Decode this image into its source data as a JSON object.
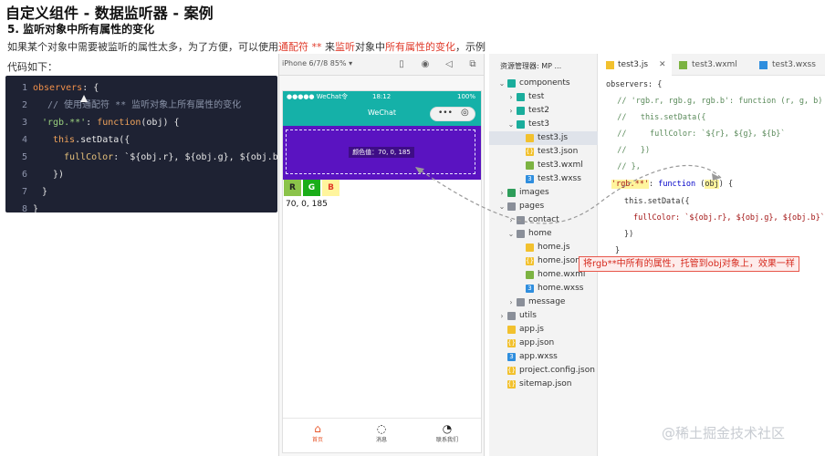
{
  "page": {
    "title": "自定义组件 - 数据监听器 - 案例",
    "heading": "5. 监听对象中所有属性的变化",
    "desc_1": "如果某个对象中需要被监听的属性太多，为了方便，可以使用",
    "desc_2": "通配符 **",
    "desc_3": " 来",
    "desc_4": "监听",
    "desc_5": "对象中",
    "desc_6": "所有属性的变化",
    "desc_7": "，示例",
    "code_label": "代码如下："
  },
  "code_panel": {
    "lines": [
      {
        "num": "1"
      },
      {
        "num": "2"
      },
      {
        "num": "3"
      },
      {
        "num": "4"
      },
      {
        "num": "5"
      },
      {
        "num": "6"
      },
      {
        "num": "7"
      },
      {
        "num": "8"
      }
    ],
    "l1_key": "observers",
    "l1_rest": ": {",
    "l2": "// 使用通配符 ** 监听对象上所有属性的变化",
    "l3_str": "'rgb.**'",
    "l3_mid": ": ",
    "l3_fn": "function",
    "l3_rest": "(obj) {",
    "l4_this": "this",
    "l4_rest": ".setData({",
    "l5_key": "fullColor",
    "l5_rest": ": `${obj.r}, ${obj.g}, ${obj.b}`",
    "l6": "})",
    "l7": "}",
    "l8": "}"
  },
  "simulator": {
    "device": "iPhone 6/7/8 85% ▾",
    "status_left": "●●●●● WeChat令",
    "status_time": "18:12",
    "status_right": "100%",
    "nav_title": "WeChat",
    "color_label": "颜色值：70, 0, 185",
    "buttons": [
      {
        "label": "R",
        "color": "#8bc34a"
      },
      {
        "label": "G",
        "color": "#1aad19"
      },
      {
        "label": "B",
        "color": "#fff59d"
      }
    ],
    "rgb_text": "70, 0, 185",
    "tabs": [
      {
        "label": "首页",
        "icon": "home-icon",
        "active": true
      },
      {
        "label": "消息",
        "icon": "message-icon",
        "active": false
      },
      {
        "label": "联系我们",
        "icon": "phone-icon",
        "active": false
      }
    ]
  },
  "explorer": {
    "title": "资源管理器: MP ...",
    "items": [
      {
        "label": "components",
        "type": "folder",
        "expanded": true
      },
      {
        "label": "test",
        "type": "folder",
        "expanded": false
      },
      {
        "label": "test2",
        "type": "folder",
        "expanded": false
      },
      {
        "label": "test3",
        "type": "folder",
        "expanded": true
      },
      {
        "label": "test3.js",
        "type": "js",
        "selected": true
      },
      {
        "label": "test3.json",
        "type": "json"
      },
      {
        "label": "test3.wxml",
        "type": "wxml"
      },
      {
        "label": "test3.wxss",
        "type": "wxss"
      },
      {
        "label": "images",
        "type": "folder",
        "expanded": false
      },
      {
        "label": "pages",
        "type": "folder",
        "expanded": true
      },
      {
        "label": "contact",
        "type": "folder",
        "expanded": false
      },
      {
        "label": "home",
        "type": "folder",
        "expanded": true
      },
      {
        "label": "home.js",
        "type": "js"
      },
      {
        "label": "home.json",
        "type": "json"
      },
      {
        "label": "home.wxml",
        "type": "wxml"
      },
      {
        "label": "home.wxss",
        "type": "wxss"
      },
      {
        "label": "message",
        "type": "folder",
        "expanded": false
      },
      {
        "label": "utils",
        "type": "folder",
        "expanded": false
      },
      {
        "label": "app.js",
        "type": "js"
      },
      {
        "label": "app.json",
        "type": "json"
      },
      {
        "label": "app.wxss",
        "type": "wxss"
      },
      {
        "label": "project.config.json",
        "type": "json"
      },
      {
        "label": "sitemap.json",
        "type": "json"
      }
    ]
  },
  "editor": {
    "tabs": [
      {
        "label": "test3.js",
        "active": true
      },
      {
        "label": "test3.wxml",
        "active": false
      },
      {
        "label": "test3.wxss",
        "active": false
      }
    ],
    "lines": {
      "l1": "observers: {",
      "l2": "  // 'rgb.r, rgb.g, rgb.b': function (r, g, b) {",
      "l3": "  //   this.setData({",
      "l4": "  //     fullColor: `${r}, ${g}, ${b}`",
      "l5": "  //   })",
      "l6": "  // },",
      "l7_str": "'rgb.**'",
      "l7_mid": ": ",
      "l7_fn": "function",
      "l7_obj": "obj",
      "l7_end": " {",
      "l8": "this.setData({",
      "l9": "fullColor: `${obj.r}, ${obj.g}, ${obj.b}`",
      "l10": "})",
      "l11": "}"
    }
  },
  "annotation": "将rgb**中所有的属性，托管到obj对象上，效果一样",
  "watermark": "@稀土掘金技术社区",
  "colors": {
    "code_bg": "#1e2233",
    "purple": "#5a13c1",
    "teal": "#15b1a8",
    "red": "#e03a2a"
  }
}
